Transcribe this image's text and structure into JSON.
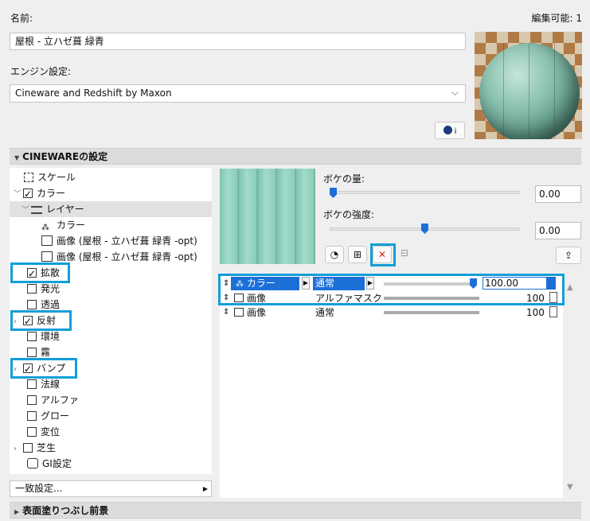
{
  "header": {
    "name_label": "名前:",
    "editable_label": "編集可能: 1",
    "material_name": "屋根 - 立ハゼ葺 緑青",
    "engine_label": "エンジン設定:",
    "engine_value": "Cineware and Redshift by Maxon"
  },
  "sections": {
    "cineware_title": "CINEWAREの設定",
    "surface_title": "表面塗りつぶし前景"
  },
  "tree": {
    "scale": "スケール",
    "color": "カラー",
    "layer": "レイヤー",
    "sub_color": "カラー",
    "image1": "画像 (屋根 - 立ハゼ葺 緑青 -opt)",
    "image2": "画像 (屋根 - 立ハゼ葺 緑青 -opt)",
    "diffuse": "拡散",
    "luminance": "発光",
    "transparency": "透過",
    "reflection": "反射",
    "environment": "環境",
    "fog": "霧",
    "bump": "バンプ",
    "normal": "法線",
    "alpha": "アルファ",
    "glow": "グロー",
    "displacement": "変位",
    "grass": "芝生",
    "gi": "GI設定"
  },
  "match_settings": "一致設定...",
  "controls": {
    "bokeh_amount_label": "ボケの量:",
    "bokeh_amount_value": "0.00",
    "bokeh_strength_label": "ボケの強度:",
    "bokeh_strength_value": "0.00"
  },
  "layers": [
    {
      "name": "カラー",
      "mode": "通常",
      "value": "100.00"
    },
    {
      "name": "画像",
      "mode": "アルファマスク",
      "value": "100"
    },
    {
      "name": "画像",
      "mode": "通常",
      "value": "100"
    }
  ],
  "colors": {
    "highlight": "#139ed8",
    "selection": "#1d6fd8",
    "delete": "#e02020"
  }
}
